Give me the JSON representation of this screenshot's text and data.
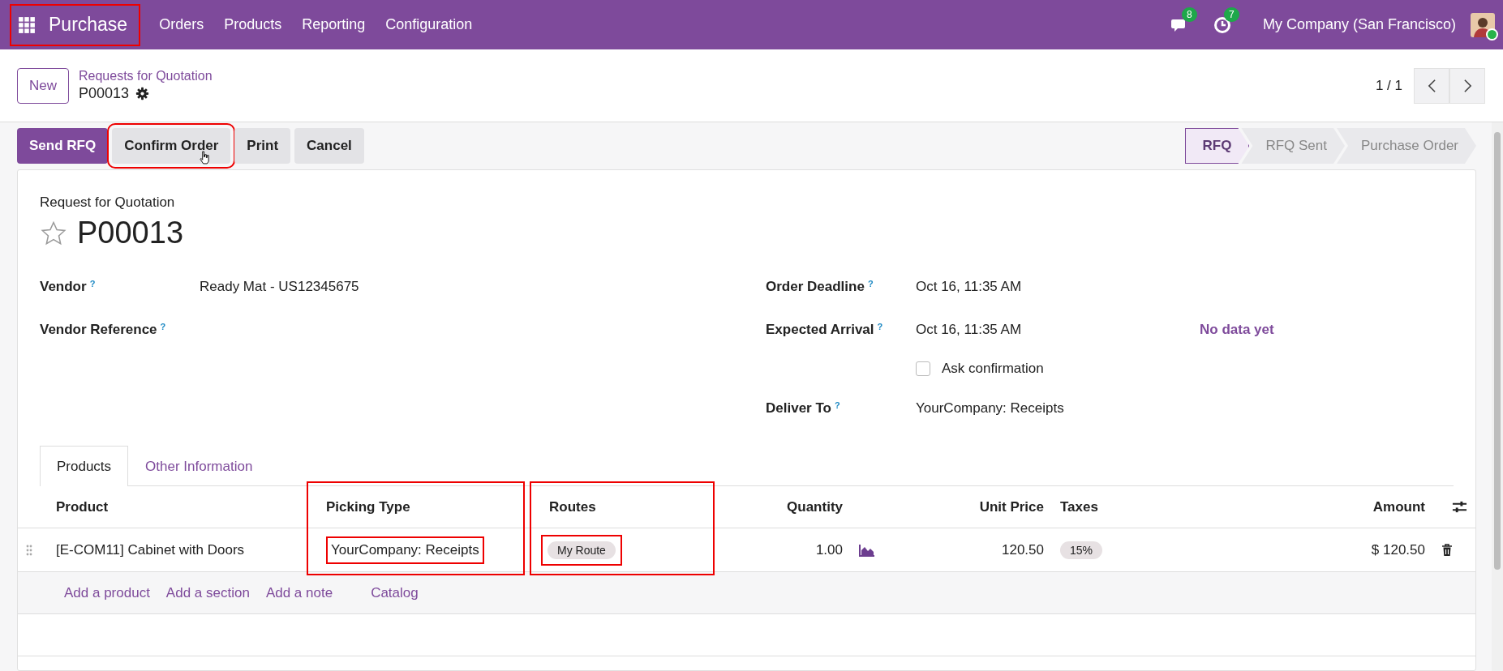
{
  "navbar": {
    "app": {
      "label": "Purchase",
      "highlighted": true
    },
    "menu": [
      "Orders",
      "Products",
      "Reporting",
      "Configuration"
    ],
    "messages_badge": "8",
    "activities_badge": "7",
    "company": "My Company (San Francisco)"
  },
  "control_panel": {
    "new_button": "New",
    "breadcrumb": "Requests for Quotation",
    "record": "P00013",
    "pager": "1 / 1"
  },
  "actions": [
    {
      "label": "Send RFQ",
      "kind": "primary",
      "highlighted": false
    },
    {
      "label": "Confirm Order",
      "kind": "secondary",
      "highlighted": true
    },
    {
      "label": "Print",
      "kind": "secondary",
      "highlighted": false
    },
    {
      "label": "Cancel",
      "kind": "secondary",
      "highlighted": false
    }
  ],
  "status_steps": [
    {
      "label": "RFQ",
      "selected": true
    },
    {
      "label": "RFQ Sent",
      "selected": false
    },
    {
      "label": "Purchase Order",
      "selected": false
    }
  ],
  "form": {
    "subtitle": "Request for Quotation",
    "title": "P00013",
    "starred": false,
    "left_fields": [
      {
        "label": "Vendor",
        "help": "?",
        "value": "Ready Mat - US12345675"
      },
      {
        "label": "Vendor Reference",
        "help": "?"
      }
    ],
    "right_fields": [
      {
        "kind": "field",
        "label": "Order Deadline",
        "help": "?",
        "value": "Oct 16, 11:35 AM"
      },
      {
        "kind": "field",
        "label": "Expected Arrival",
        "help": "?",
        "value": "Oct 16, 11:35 AM",
        "extra": "No data yet"
      },
      {
        "kind": "checkbox",
        "label": "Ask confirmation",
        "checked": false
      },
      {
        "kind": "field",
        "label": "Deliver To",
        "help": "?",
        "value": "YourCompany: Receipts"
      }
    ]
  },
  "tabs": [
    {
      "label": "Products",
      "selected": true
    },
    {
      "label": "Other Information",
      "selected": false
    }
  ],
  "table": {
    "columns": [
      {
        "label": "Product",
        "highlighted": false
      },
      {
        "label": "Picking Type",
        "highlighted": true
      },
      {
        "label": "Routes",
        "highlighted": true
      },
      {
        "label": "Quantity",
        "highlighted": false
      },
      {
        "label": "Unit Price",
        "highlighted": false
      },
      {
        "label": "Taxes",
        "highlighted": false
      },
      {
        "label": "Amount",
        "highlighted": false
      }
    ],
    "rows": [
      {
        "product": "[E-COM11] Cabinet with Doors",
        "picking_type": {
          "text": "YourCompany: Receipts",
          "highlighted": true
        },
        "route": {
          "text": "My Route",
          "highlighted": true
        },
        "quantity": "1.00",
        "unit_price": "120.50",
        "tax": "15%",
        "amount": "$ 120.50"
      }
    ],
    "add_links": [
      "Add a product",
      "Add a section",
      "Add a note",
      "Catalog"
    ]
  }
}
